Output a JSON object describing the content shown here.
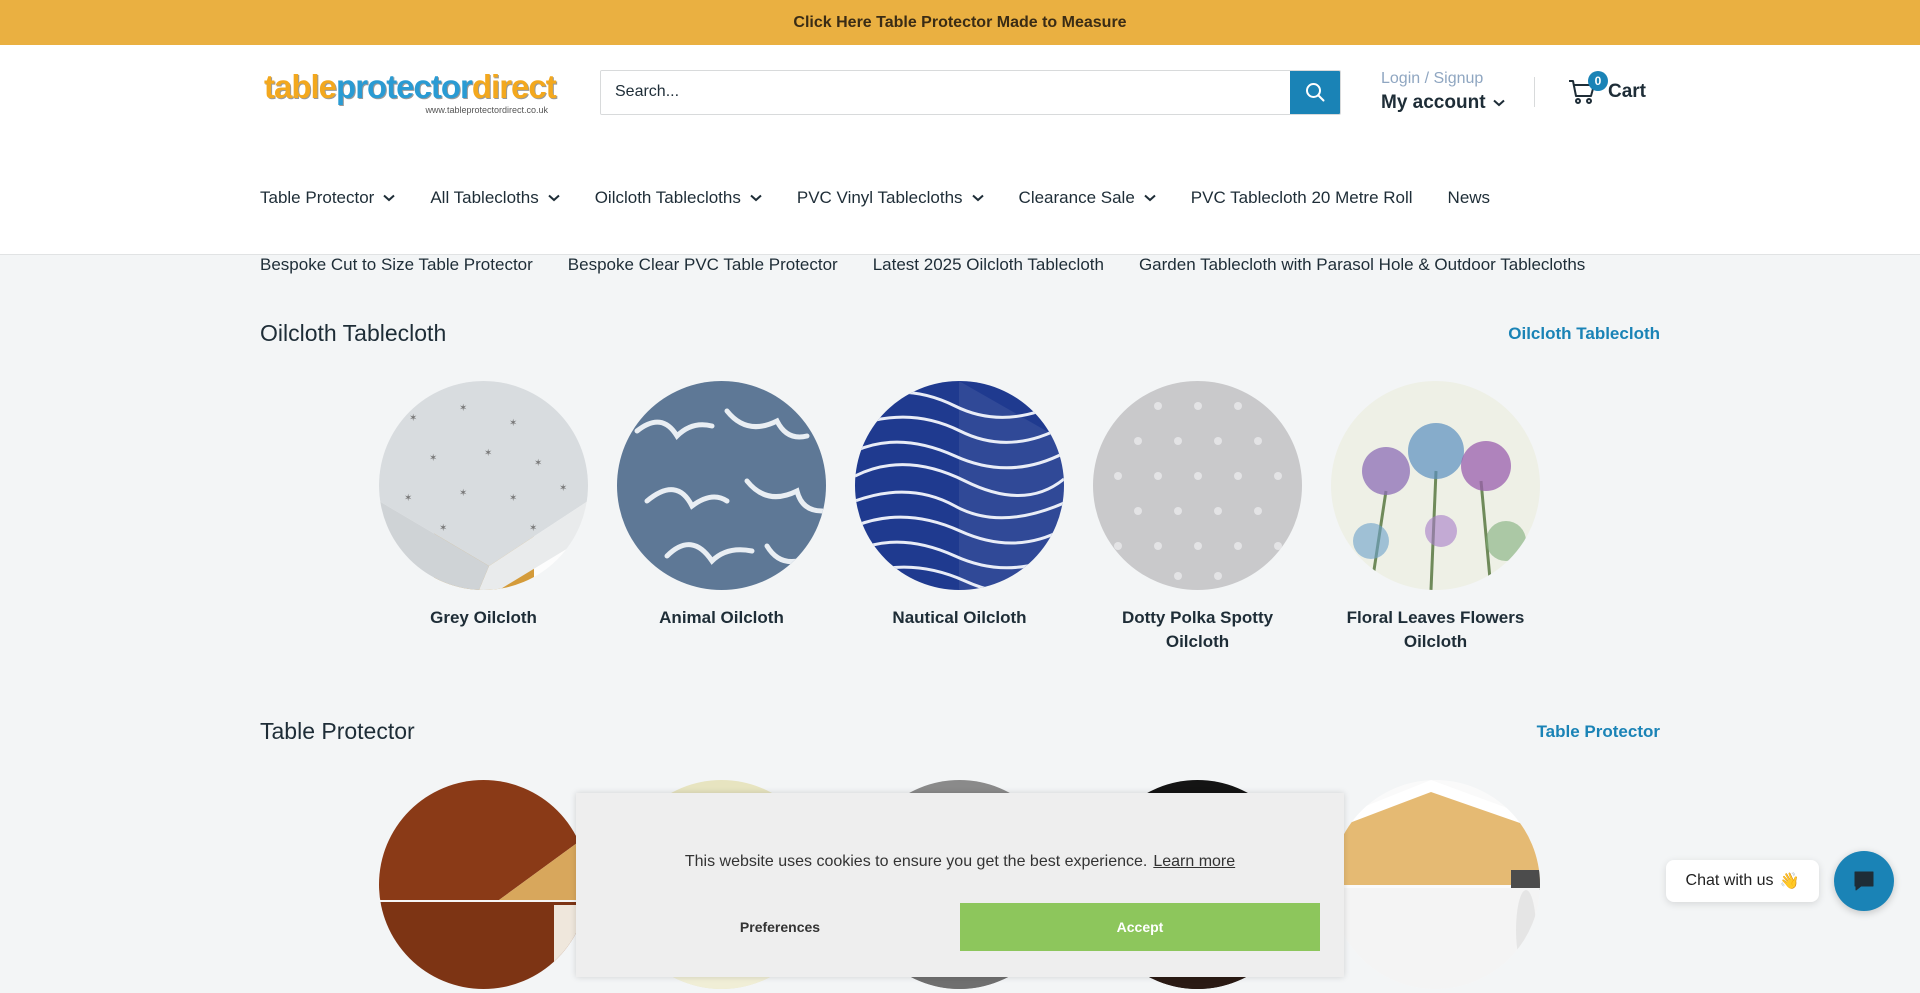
{
  "announcement": {
    "text": "Click Here Table Protector Made to Measure"
  },
  "header": {
    "logo": {
      "part1": "table",
      "part2": "protector",
      "part3": "direct",
      "sub": "www.tableprotectordirect.co.uk"
    },
    "search": {
      "placeholder": "Search...",
      "icon": "search-icon"
    },
    "account": {
      "login_label": "Login / Signup",
      "my_account_label": "My account"
    },
    "cart": {
      "count": "0",
      "label": "Cart"
    }
  },
  "nav": {
    "row1": [
      {
        "label": "Table Protector",
        "has_dropdown": true
      },
      {
        "label": "All Tablecloths",
        "has_dropdown": true
      },
      {
        "label": "Oilcloth Tablecloths",
        "has_dropdown": true
      },
      {
        "label": "PVC Vinyl Tablecloths",
        "has_dropdown": true
      },
      {
        "label": "Clearance Sale",
        "has_dropdown": true
      },
      {
        "label": "PVC Tablecloth 20 Metre Roll",
        "has_dropdown": false
      },
      {
        "label": "News",
        "has_dropdown": false
      }
    ],
    "row2": [
      {
        "label": "Bespoke Cut to Size Table Protector"
      },
      {
        "label": "Bespoke Clear PVC Table Protector"
      },
      {
        "label": "Latest 2025 Oilcloth Tablecloth"
      },
      {
        "label": "Garden Tablecloth with Parasol Hole & Outdoor Tablecloths"
      }
    ]
  },
  "sections": [
    {
      "title": "Oilcloth Tablecloth",
      "link": "Oilcloth Tablecloth",
      "items": [
        {
          "label": "Grey Oilcloth"
        },
        {
          "label": "Animal Oilcloth"
        },
        {
          "label": "Nautical Oilcloth"
        },
        {
          "label": "Dotty Polka Spotty Oilcloth"
        },
        {
          "label": "Floral Leaves Flowers Oilcloth"
        }
      ]
    },
    {
      "title": "Table Protector",
      "link": "Table Protector"
    }
  ],
  "cookie_banner": {
    "text": "This website uses cookies to ensure you get the best experience.",
    "learn_more": "Learn more",
    "preferences": "Preferences",
    "accept": "Accept"
  },
  "chat": {
    "bubble_text": "Chat with us",
    "emoji": "👋"
  },
  "colors": {
    "announcement_bg": "#eab041",
    "accent": "#1a83b6",
    "accept": "#8dc65c"
  }
}
